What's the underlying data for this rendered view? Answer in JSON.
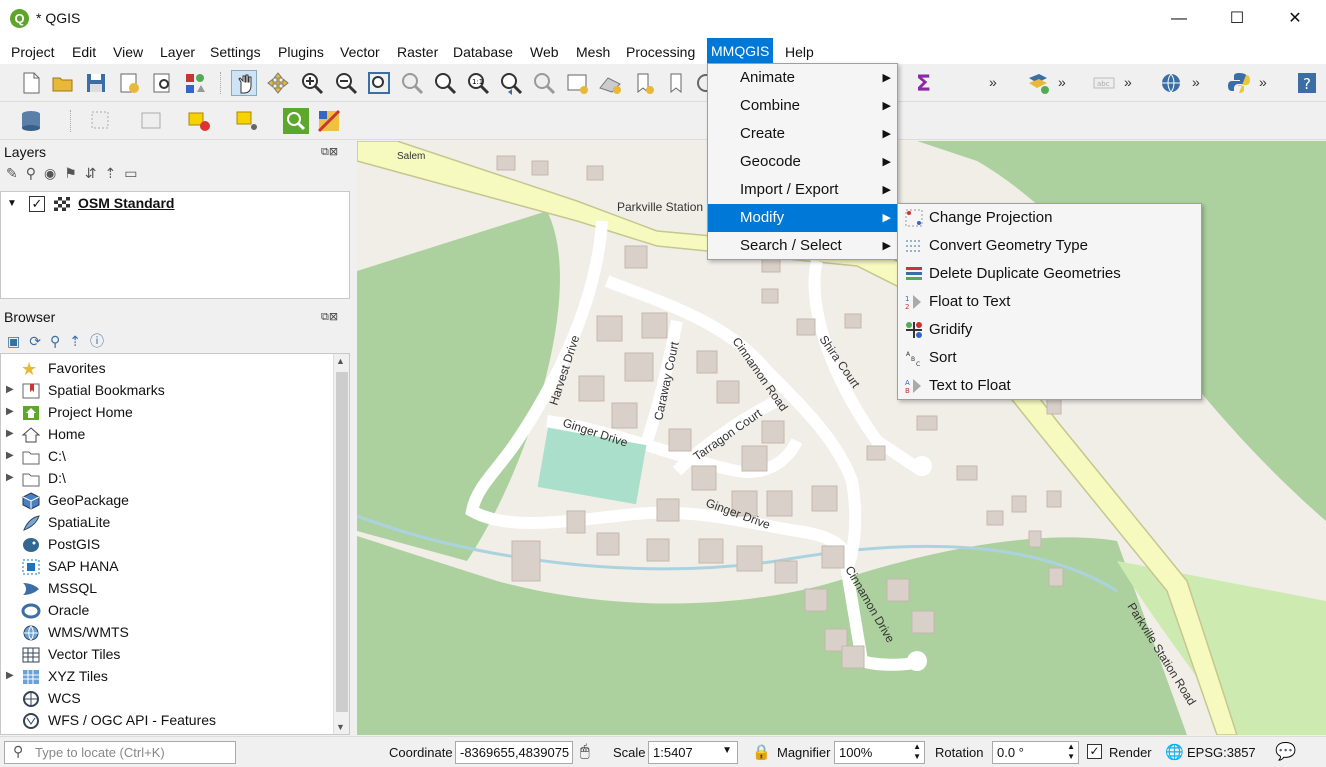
{
  "window": {
    "title": "* QGIS",
    "minimize": "—",
    "maximize": "☐",
    "close": "✕",
    "app_icon": "Q"
  },
  "menubar": [
    "Project",
    "Edit",
    "View",
    "Layer",
    "Settings",
    "Plugins",
    "Vector",
    "Raster",
    "Database",
    "Web",
    "Mesh",
    "Processing",
    "MMQGIS",
    "Help"
  ],
  "layers_panel": {
    "title": "Layers",
    "layer_name": "OSM Standard"
  },
  "browser_panel": {
    "title": "Browser",
    "items": [
      "Favorites",
      "Spatial Bookmarks",
      "Project Home",
      "Home",
      "C:\\",
      "D:\\",
      "GeoPackage",
      "SpatiaLite",
      "PostGIS",
      "SAP HANA",
      "MSSQL",
      "Oracle",
      "WMS/WMTS",
      "Vector Tiles",
      "XYZ Tiles",
      "WCS",
      "WFS / OGC API - Features"
    ]
  },
  "mmqgis_menu": [
    "Animate",
    "Combine",
    "Create",
    "Geocode",
    "Import / Export",
    "Modify",
    "Search / Select"
  ],
  "modify_submenu": [
    "Change Projection",
    "Convert Geometry Type",
    "Delete Duplicate Geometries",
    "Float to Text",
    "Gridify",
    "Sort",
    "Text to Float"
  ],
  "map_labels": [
    "Parkville Station",
    "Salem",
    "Harvest Drive",
    "Caraway Court",
    "Cinnamon Road",
    "Shira Court",
    "Ginger Drive",
    "Tarragon Court",
    "Ginger Drive",
    "Cinnamon Drive",
    "Parkville Station Road"
  ],
  "statusbar": {
    "locate_placeholder": "Type to locate (Ctrl+K)",
    "coordinate_label": "Coordinate",
    "coordinate_value": "-8369655,4839075",
    "scale_label": "Scale",
    "scale_value": "1:5407",
    "magnifier_label": "Magnifier",
    "magnifier_value": "100%",
    "rotation_label": "Rotation",
    "rotation_value": "0.0 °",
    "render_label": "Render",
    "crs": "EPSG:3857"
  },
  "toolbar_overflow": "»",
  "colors": {
    "accent": "#0078d7",
    "map_bg": "#f1eee8",
    "wood": "#add19e",
    "road": "#f7fabf",
    "building": "#d9d0c9",
    "water": "#aad3df"
  }
}
